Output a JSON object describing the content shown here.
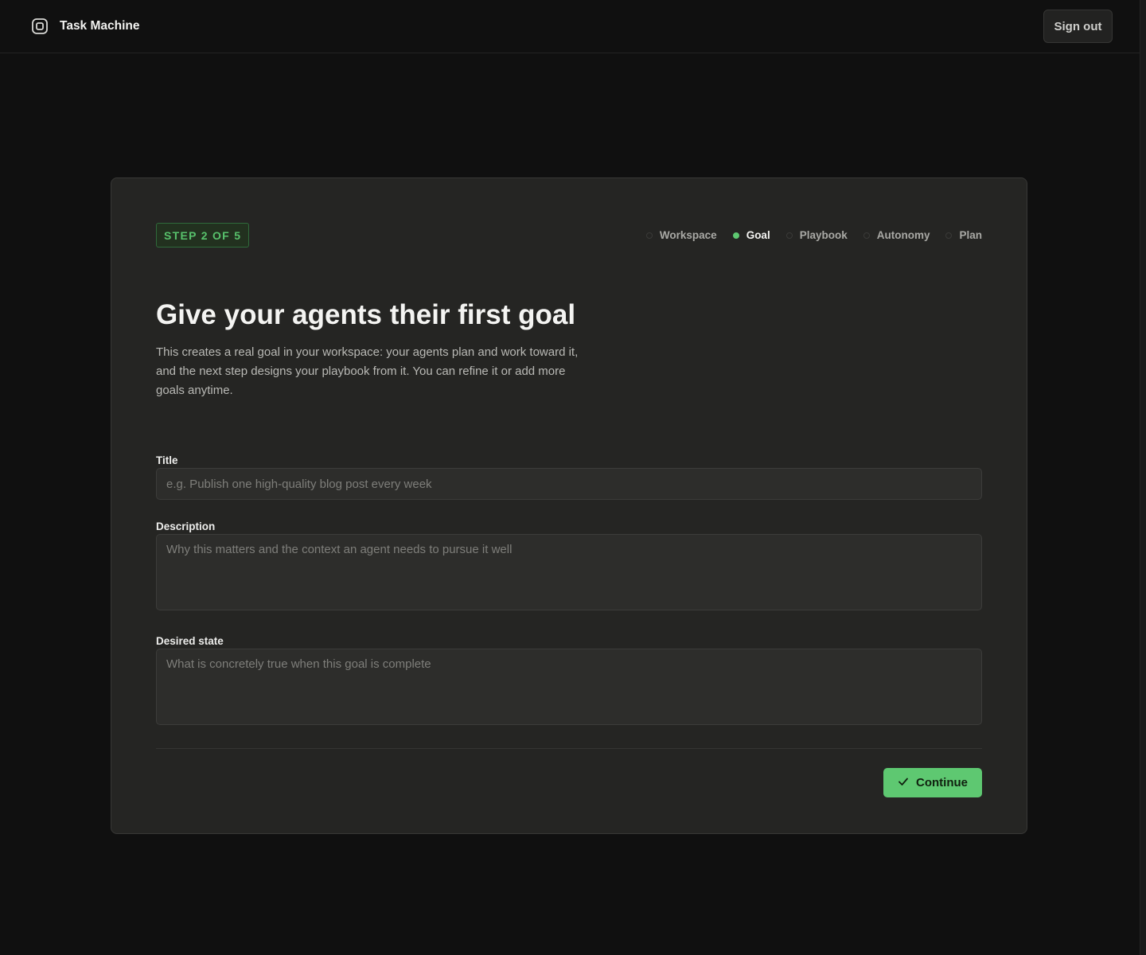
{
  "header": {
    "app_name": "Task Machine",
    "brand_icon": "app-logo-icon",
    "sign_out_label": "Sign out"
  },
  "onboarding": {
    "step_badge": "STEP 2 OF 5",
    "steps": [
      {
        "label": "Workspace",
        "active": false
      },
      {
        "label": "Goal",
        "active": true
      },
      {
        "label": "Playbook",
        "active": false
      },
      {
        "label": "Autonomy",
        "active": false
      },
      {
        "label": "Plan",
        "active": false
      }
    ],
    "heading": "Give your agents their first goal",
    "description": "This creates a real goal in your workspace: your agents plan and work toward it, and the next step designs your playbook from it. You can refine it or add more goals anytime."
  },
  "form": {
    "title": {
      "label": "Title",
      "value": "",
      "placeholder": "e.g. Publish one high-quality blog post every week"
    },
    "description": {
      "label": "Description",
      "value": "",
      "placeholder": "Why this matters and the context an agent needs to pursue it well"
    },
    "desired_state": {
      "label": "Desired state",
      "value": "",
      "placeholder": "What is concretely true when this goal is complete"
    },
    "continue_label": "Continue",
    "continue_icon": "check-icon"
  },
  "colors": {
    "accent": "#5ec871",
    "background": "#101010",
    "card": "#252523"
  }
}
